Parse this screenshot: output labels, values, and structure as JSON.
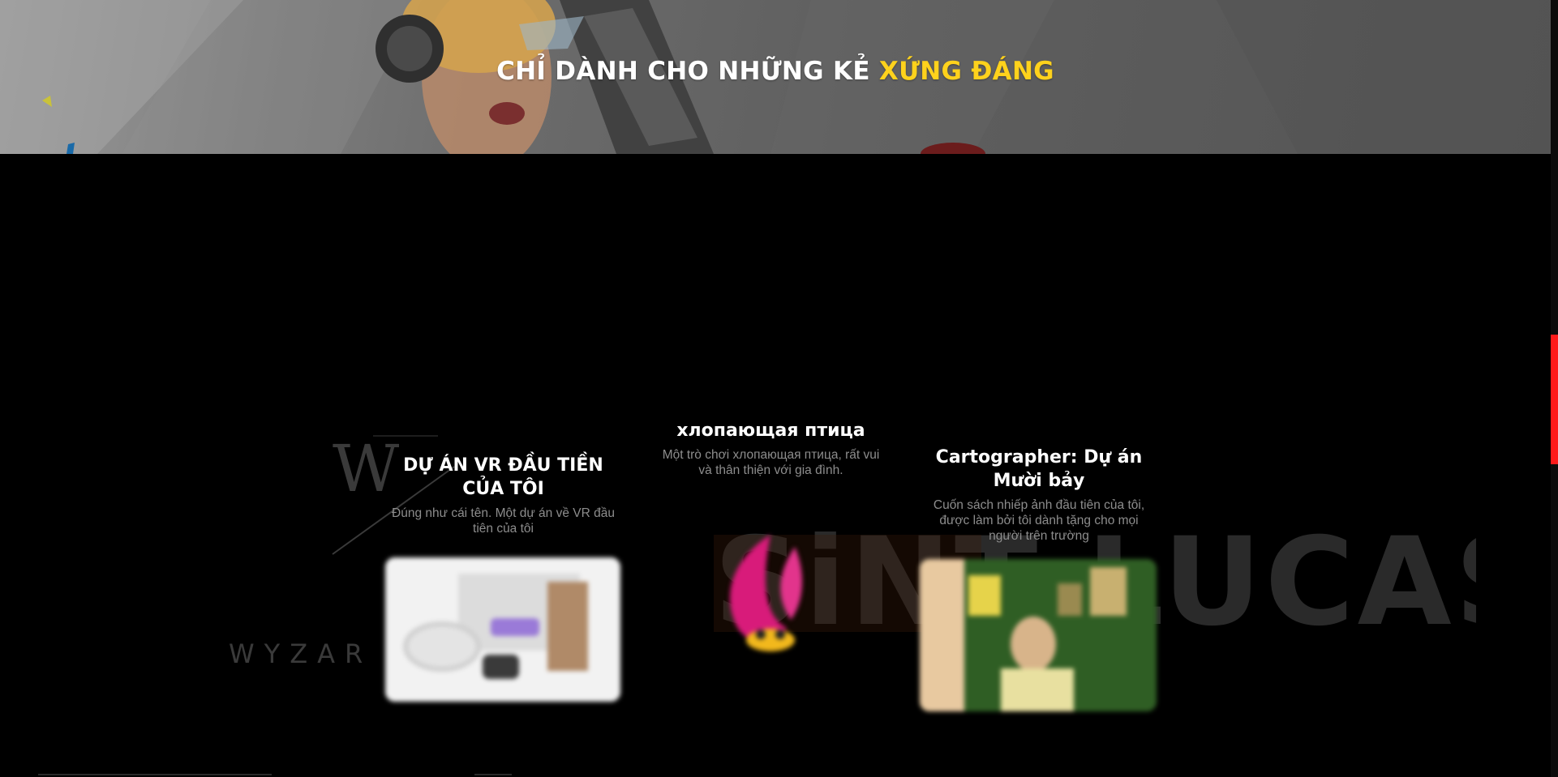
{
  "hero": {
    "title_main": "CHỈ DÀNH CHO NHỮNG KẺ ",
    "title_accent": "XỨNG ĐÁNG",
    "accent_color": "#ffd21c"
  },
  "background_logos": {
    "wyzard_text": "WYZAR",
    "sintlucas_text": "SiNT LUCAS"
  },
  "projects": [
    {
      "title": "DỰ ÁN VR ĐẦU TIỀN CỦA TÔI",
      "description": "Đúng như cái tên. Một dự án về VR đầu tiên của tôi",
      "image_icon": "vr-headset-image"
    },
    {
      "title": "хлопающая птица",
      "description": "Một trò chơi хлопающая птица, rất vui và thân thiện với gia đình.",
      "image_icon": "flappy-bird-image"
    },
    {
      "title": "Cartographer: Dự án Mười bảy",
      "description": "Cuốn sách nhiếp ảnh đầu tiên của tôi, được làm bởi tôi dành tặng cho mọi người trên trường",
      "image_icon": "photo-book-image"
    }
  ],
  "scrollbar": {
    "color": "#ff1a1a"
  }
}
